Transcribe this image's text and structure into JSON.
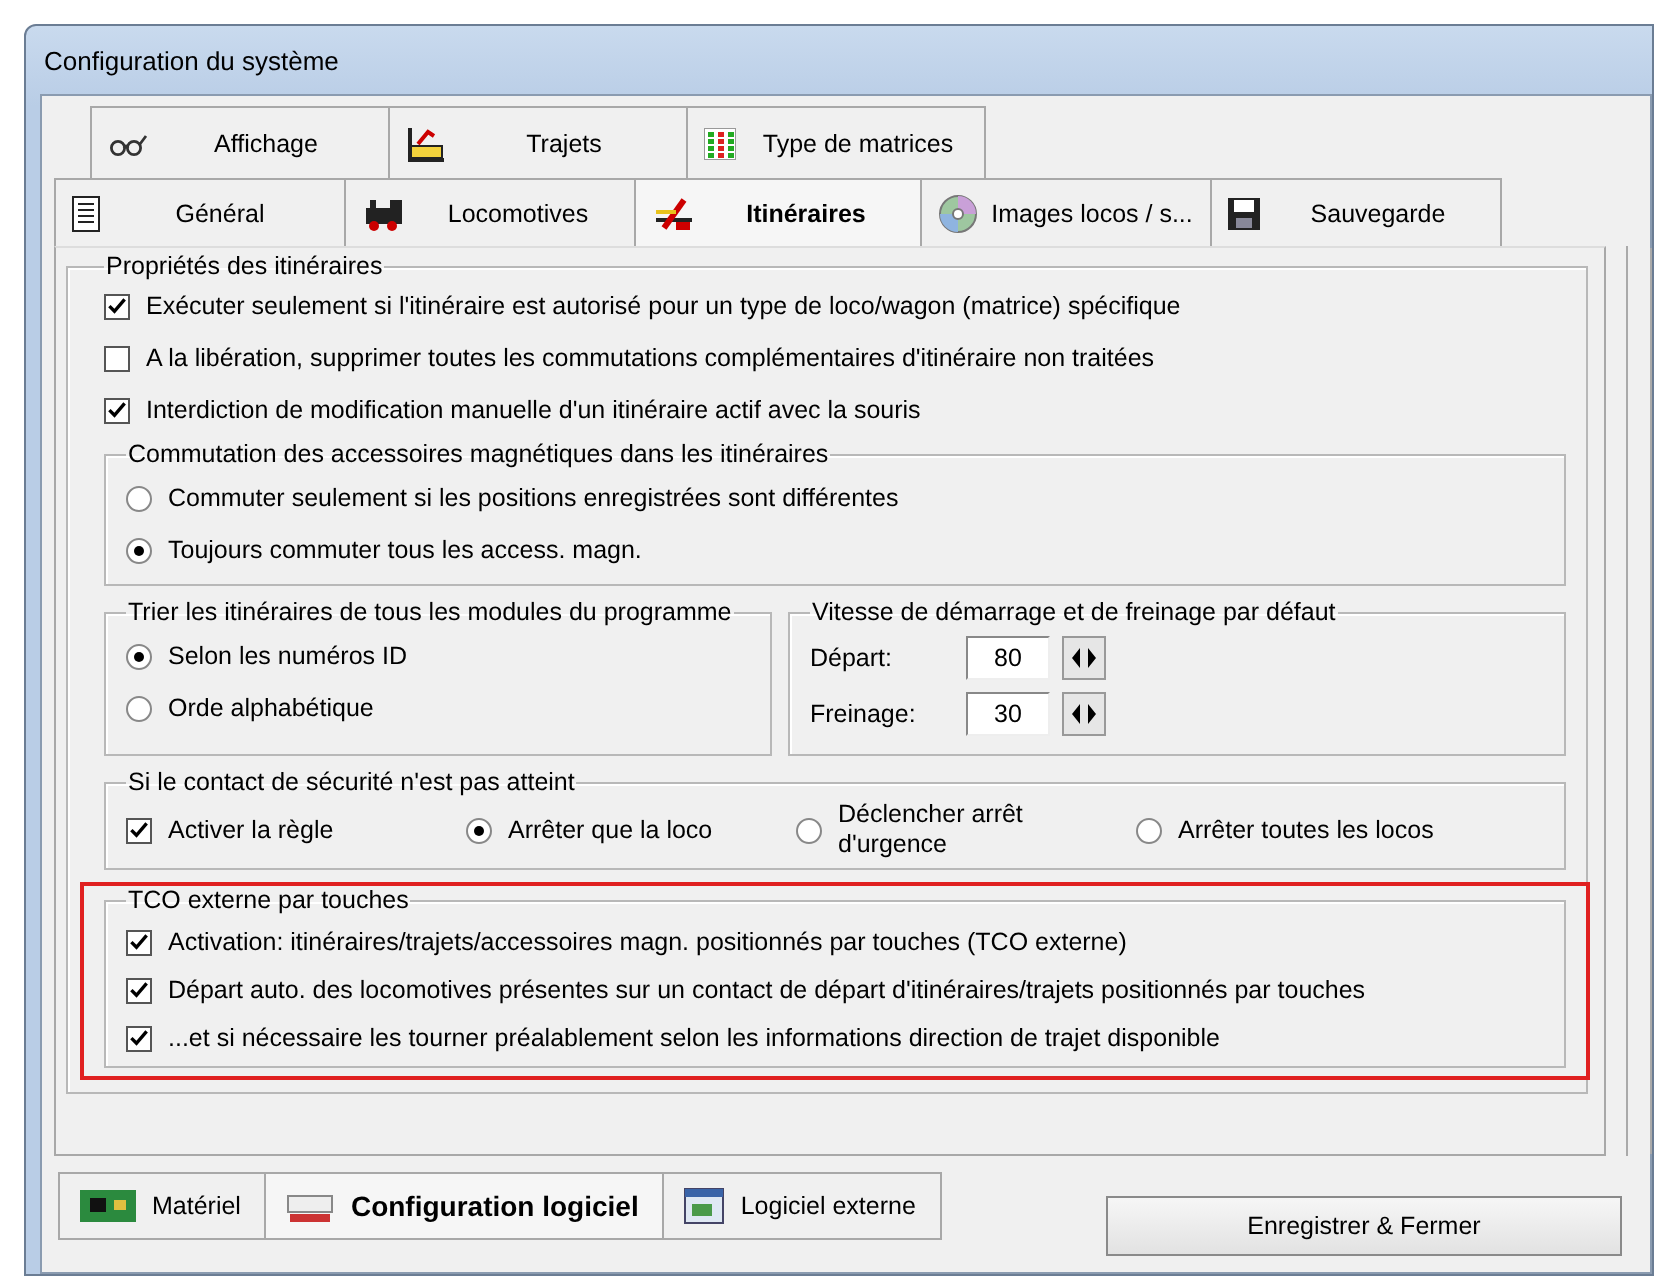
{
  "window": {
    "title": "Configuration du système"
  },
  "tabs_row_1": [
    {
      "label": "Affichage",
      "selected": false
    },
    {
      "label": "Trajets",
      "selected": false
    },
    {
      "label": "Type de matrices",
      "selected": false
    }
  ],
  "tabs_row_2": [
    {
      "label": "Général",
      "selected": false
    },
    {
      "label": "Locomotives",
      "selected": false
    },
    {
      "label": "Itinéraires",
      "selected": true
    },
    {
      "label": "Images locos / s...",
      "selected": false
    },
    {
      "label": "Sauvegarde",
      "selected": false
    }
  ],
  "properties": {
    "title": "Propriétés des itinéraires",
    "options": [
      {
        "label": "Exécuter seulement si l'itinéraire est autorisé pour un type de loco/wagon (matrice) spécifique",
        "checked": true
      },
      {
        "label": "A la libération, supprimer toutes les commutations complémentaires d'itinéraire non traitées",
        "checked": false
      },
      {
        "label": "Interdiction de modification manuelle d'un itinéraire actif avec la souris",
        "checked": true
      }
    ]
  },
  "magnetic": {
    "title": "Commutation des accessoires magnétiques dans les itinéraires",
    "options": [
      {
        "label": "Commuter seulement si les positions enregistrées sont différentes",
        "selected": false
      },
      {
        "label": "Toujours commuter tous les access. magn.",
        "selected": true
      }
    ]
  },
  "sorting": {
    "title": "Trier les itinéraires de tous les modules du programme",
    "options": [
      {
        "label": "Selon les numéros ID",
        "selected": true
      },
      {
        "label": "Orde alphabétique",
        "selected": false
      }
    ]
  },
  "speed": {
    "title": "Vitesse de démarrage et de freinage par défaut",
    "fields": [
      {
        "label": "Départ:",
        "value": "80"
      },
      {
        "label": "Freinage:",
        "value": "30"
      }
    ]
  },
  "safety": {
    "title": "Si le contact de sécurité n'est pas atteint",
    "options": [
      {
        "kind": "checkbox",
        "label": "Activer la règle",
        "checked": true
      },
      {
        "kind": "radio",
        "label": "Arrêter que la loco",
        "selected": true
      },
      {
        "kind": "radio",
        "label": "Déclencher arrêt d'urgence",
        "selected": false
      },
      {
        "kind": "radio",
        "label": "Arrêter toutes les locos",
        "selected": false
      }
    ]
  },
  "external_panel": {
    "title": "TCO externe par touches",
    "highlighted": true,
    "options": [
      {
        "label": "Activation: itinéraires/trajets/accessoires magn. positionnés par touches (TCO externe)",
        "checked": true
      },
      {
        "label": "Départ auto. des locomotives présentes sur un contact de départ d'itinéraires/trajets positionnés par touches",
        "checked": true
      },
      {
        "label": "...et si nécessaire les tourner préalablement selon les informations direction de trajet disponible",
        "checked": true
      }
    ]
  },
  "bottom_tabs": [
    {
      "label": "Matériel",
      "selected": false
    },
    {
      "label": "Configuration logiciel",
      "selected": true
    },
    {
      "label": "Logiciel externe",
      "selected": false
    }
  ],
  "save_button": "Enregistrer & Fermer"
}
